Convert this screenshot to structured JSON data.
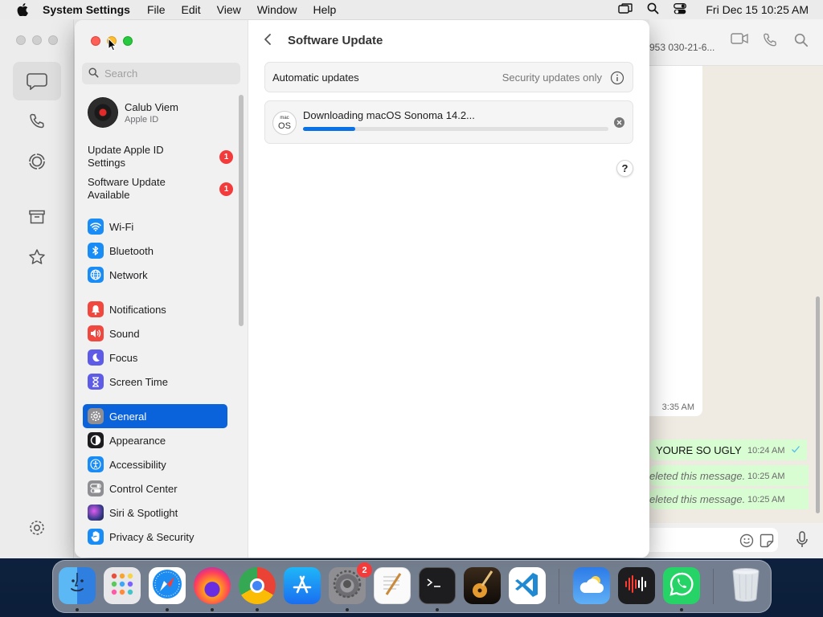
{
  "menubar": {
    "app_name": "System Settings",
    "menus": [
      "File",
      "Edit",
      "View",
      "Window",
      "Help"
    ],
    "clock": "Fri Dec 15  10:25 AM"
  },
  "whatsapp": {
    "contact_phone": "953 030-21-6...",
    "incoming_time": "3:35 AM",
    "messages": [
      {
        "text": "YOURE SO UGLY",
        "time": "10:24 AM",
        "deleted": false
      },
      {
        "text": "eleted this message.",
        "time": "10:25 AM",
        "deleted": true
      },
      {
        "text": "eleted this message.",
        "time": "10:25 AM",
        "deleted": true
      }
    ]
  },
  "settings": {
    "search_placeholder": "Search",
    "account": {
      "name": "Calub Viem",
      "subtitle": "Apple ID"
    },
    "notices": [
      {
        "label": "Update Apple ID Settings",
        "count": "1"
      },
      {
        "label": "Software Update Available",
        "count": "1"
      }
    ],
    "sidebar_items": [
      {
        "label": "Wi-Fi",
        "icon": "wifi-icon",
        "color": "#1a8cf5"
      },
      {
        "label": "Bluetooth",
        "icon": "bluetooth-icon",
        "color": "#1a8cf5"
      },
      {
        "label": "Network",
        "icon": "globe-icon",
        "color": "#1a8cf5"
      },
      {
        "label": "Notifications",
        "icon": "bell-icon",
        "color": "#f0473e"
      },
      {
        "label": "Sound",
        "icon": "speaker-icon",
        "color": "#f0473e"
      },
      {
        "label": "Focus",
        "icon": "moon-icon",
        "color": "#5e5ce6"
      },
      {
        "label": "Screen Time",
        "icon": "hourglass-icon",
        "color": "#5e5ce6"
      },
      {
        "label": "General",
        "icon": "gear-icon",
        "color": "#8e8e93"
      },
      {
        "label": "Appearance",
        "icon": "appearance-icon",
        "color": "#1c1c1e"
      },
      {
        "label": "Accessibility",
        "icon": "accessibility-icon",
        "color": "#1a8cf5"
      },
      {
        "label": "Control Center",
        "icon": "control-center-icon",
        "color": "#8e8e93"
      },
      {
        "label": "Siri & Spotlight",
        "icon": "siri-icon",
        "color": "#3b3b8f"
      },
      {
        "label": "Privacy & Security",
        "icon": "hand-icon",
        "color": "#1a8cf5"
      }
    ],
    "page_title": "Software Update",
    "auto_updates": {
      "label": "Automatic updates",
      "value": "Security updates only"
    },
    "download": {
      "os_line1": "mac",
      "os_line2": "OS",
      "label": "Downloading macOS Sonoma 14.2...",
      "progress": 0.17
    },
    "help_label": "?"
  },
  "dock": {
    "apps": [
      {
        "name": "Finder",
        "icon": "finder-icon",
        "running": true
      },
      {
        "name": "Launchpad",
        "icon": "launchpad-icon",
        "running": false
      },
      {
        "name": "Safari",
        "icon": "safari-icon",
        "running": true
      },
      {
        "name": "Firefox",
        "icon": "firefox-icon",
        "running": true
      },
      {
        "name": "Chrome",
        "icon": "chrome-icon",
        "running": true
      },
      {
        "name": "App Store",
        "icon": "app-store-icon",
        "running": false
      },
      {
        "name": "System Settings",
        "icon": "system-settings-icon",
        "running": true,
        "badge": "2"
      },
      {
        "name": "TextEdit",
        "icon": "textedit-icon",
        "running": false
      },
      {
        "name": "Terminal",
        "icon": "terminal-icon",
        "running": true
      },
      {
        "name": "GarageBand",
        "icon": "garageband-icon",
        "running": false
      },
      {
        "name": "VS Code",
        "icon": "vscode-icon",
        "running": false
      },
      {
        "name": "Weather",
        "icon": "weather-icon",
        "running": false
      },
      {
        "name": "Voice Memos",
        "icon": "voice-memos-icon",
        "running": false
      },
      {
        "name": "WhatsApp",
        "icon": "whatsapp-icon",
        "running": true
      },
      {
        "name": "Trash",
        "icon": "trash-icon",
        "running": false
      }
    ]
  }
}
